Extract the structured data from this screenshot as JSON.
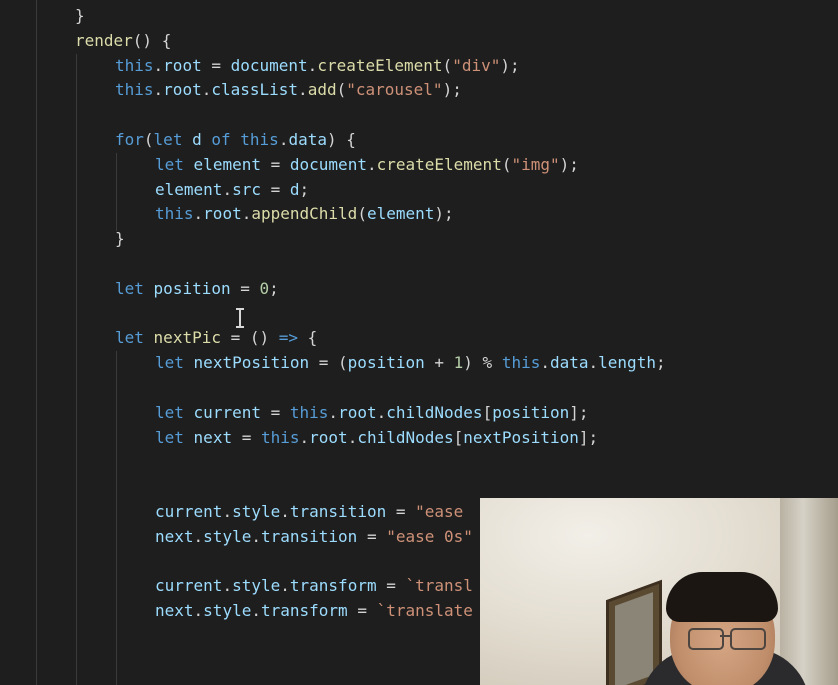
{
  "editor": {
    "theme": {
      "background": "#1e1e1e",
      "keyword": "#569cd6",
      "variable": "#9cdcfe",
      "function": "#dcdcaa",
      "string": "#ce9178",
      "number": "#b5cea8",
      "plain": "#d4d4d4",
      "indent_guide": "#3a3a3a"
    },
    "lines": [
      {
        "tokens": [
          [
            "}",
            "punc"
          ]
        ]
      },
      {
        "tokens": [
          [
            "render",
            "fn"
          ],
          [
            "() {",
            "punc"
          ]
        ]
      },
      {
        "tokens": [
          [
            "this",
            "kw"
          ],
          [
            ".",
            "punc"
          ],
          [
            "root",
            "var"
          ],
          [
            " = ",
            "punc"
          ],
          [
            "document",
            "var"
          ],
          [
            ".",
            "punc"
          ],
          [
            "createElement",
            "fn"
          ],
          [
            "(",
            "punc"
          ],
          [
            "\"div\"",
            "str"
          ],
          [
            ");",
            "punc"
          ]
        ]
      },
      {
        "tokens": [
          [
            "this",
            "kw"
          ],
          [
            ".",
            "punc"
          ],
          [
            "root",
            "var"
          ],
          [
            ".",
            "punc"
          ],
          [
            "classList",
            "var"
          ],
          [
            ".",
            "punc"
          ],
          [
            "add",
            "fn"
          ],
          [
            "(",
            "punc"
          ],
          [
            "\"carousel\"",
            "str"
          ],
          [
            ");",
            "punc"
          ]
        ]
      },
      {
        "tokens": []
      },
      {
        "tokens": [
          [
            "for",
            "kw"
          ],
          [
            "(",
            "punc"
          ],
          [
            "let",
            "kw"
          ],
          [
            " ",
            "punc"
          ],
          [
            "d",
            "var"
          ],
          [
            " ",
            "punc"
          ],
          [
            "of",
            "kw"
          ],
          [
            " ",
            "punc"
          ],
          [
            "this",
            "kw"
          ],
          [
            ".",
            "punc"
          ],
          [
            "data",
            "var"
          ],
          [
            ") {",
            "punc"
          ]
        ]
      },
      {
        "tokens": [
          [
            "let",
            "kw"
          ],
          [
            " ",
            "punc"
          ],
          [
            "element",
            "var"
          ],
          [
            " = ",
            "punc"
          ],
          [
            "document",
            "var"
          ],
          [
            ".",
            "punc"
          ],
          [
            "createElement",
            "fn"
          ],
          [
            "(",
            "punc"
          ],
          [
            "\"img\"",
            "str"
          ],
          [
            ");",
            "punc"
          ]
        ]
      },
      {
        "tokens": [
          [
            "element",
            "var"
          ],
          [
            ".",
            "punc"
          ],
          [
            "src",
            "var"
          ],
          [
            " = ",
            "punc"
          ],
          [
            "d",
            "var"
          ],
          [
            ";",
            "punc"
          ]
        ]
      },
      {
        "tokens": [
          [
            "this",
            "kw"
          ],
          [
            ".",
            "punc"
          ],
          [
            "root",
            "var"
          ],
          [
            ".",
            "punc"
          ],
          [
            "appendChild",
            "fn"
          ],
          [
            "(",
            "punc"
          ],
          [
            "element",
            "var"
          ],
          [
            ");",
            "punc"
          ]
        ]
      },
      {
        "tokens": [
          [
            "}",
            "punc"
          ]
        ]
      },
      {
        "tokens": []
      },
      {
        "tokens": [
          [
            "let",
            "kw"
          ],
          [
            " ",
            "punc"
          ],
          [
            "position",
            "var"
          ],
          [
            " = ",
            "punc"
          ],
          [
            "0",
            "num"
          ],
          [
            ";",
            "punc"
          ]
        ]
      },
      {
        "tokens": []
      },
      {
        "tokens": [
          [
            "let",
            "kw"
          ],
          [
            " ",
            "punc"
          ],
          [
            "nextPic",
            "fn"
          ],
          [
            " = () ",
            "punc"
          ],
          [
            "=>",
            "kw"
          ],
          [
            " {",
            "punc"
          ]
        ]
      },
      {
        "tokens": [
          [
            "let",
            "kw"
          ],
          [
            " ",
            "punc"
          ],
          [
            "nextPosition",
            "var"
          ],
          [
            " = (",
            "punc"
          ],
          [
            "position",
            "var"
          ],
          [
            " + ",
            "punc"
          ],
          [
            "1",
            "num"
          ],
          [
            ") % ",
            "punc"
          ],
          [
            "this",
            "kw"
          ],
          [
            ".",
            "punc"
          ],
          [
            "data",
            "var"
          ],
          [
            ".",
            "punc"
          ],
          [
            "length",
            "var"
          ],
          [
            ";",
            "punc"
          ]
        ]
      },
      {
        "tokens": []
      },
      {
        "tokens": [
          [
            "let",
            "kw"
          ],
          [
            " ",
            "punc"
          ],
          [
            "current",
            "var"
          ],
          [
            " = ",
            "punc"
          ],
          [
            "this",
            "kw"
          ],
          [
            ".",
            "punc"
          ],
          [
            "root",
            "var"
          ],
          [
            ".",
            "punc"
          ],
          [
            "childNodes",
            "var"
          ],
          [
            "[",
            "punc"
          ],
          [
            "position",
            "var"
          ],
          [
            "];",
            "punc"
          ]
        ]
      },
      {
        "tokens": [
          [
            "let",
            "kw"
          ],
          [
            " ",
            "punc"
          ],
          [
            "next",
            "var"
          ],
          [
            " = ",
            "punc"
          ],
          [
            "this",
            "kw"
          ],
          [
            ".",
            "punc"
          ],
          [
            "root",
            "var"
          ],
          [
            ".",
            "punc"
          ],
          [
            "childNodes",
            "var"
          ],
          [
            "[",
            "punc"
          ],
          [
            "nextPosition",
            "var"
          ],
          [
            "];",
            "punc"
          ]
        ]
      },
      {
        "tokens": []
      },
      {
        "tokens": []
      },
      {
        "tokens": [
          [
            "current",
            "var"
          ],
          [
            ".",
            "punc"
          ],
          [
            "style",
            "var"
          ],
          [
            ".",
            "punc"
          ],
          [
            "transition",
            "var"
          ],
          [
            " = ",
            "punc"
          ],
          [
            "\"ease",
            "str"
          ]
        ]
      },
      {
        "tokens": [
          [
            "next",
            "var"
          ],
          [
            ".",
            "punc"
          ],
          [
            "style",
            "var"
          ],
          [
            ".",
            "punc"
          ],
          [
            "transition",
            "var"
          ],
          [
            " = ",
            "punc"
          ],
          [
            "\"ease 0s\"",
            "str"
          ]
        ]
      },
      {
        "tokens": []
      },
      {
        "tokens": [
          [
            "current",
            "var"
          ],
          [
            ".",
            "punc"
          ],
          [
            "style",
            "var"
          ],
          [
            ".",
            "punc"
          ],
          [
            "transform",
            "var"
          ],
          [
            " = ",
            "punc"
          ],
          [
            "`transl",
            "str"
          ]
        ]
      },
      {
        "tokens": [
          [
            "next",
            "var"
          ],
          [
            ".",
            "punc"
          ],
          [
            "style",
            "var"
          ],
          [
            ".",
            "punc"
          ],
          [
            "transform",
            "var"
          ],
          [
            " = ",
            "punc"
          ],
          [
            "`translate",
            "str"
          ]
        ]
      }
    ]
  },
  "cursor": {
    "icon": "text-cursor-icon"
  },
  "webcam": {
    "icon": "presenter-webcam"
  }
}
